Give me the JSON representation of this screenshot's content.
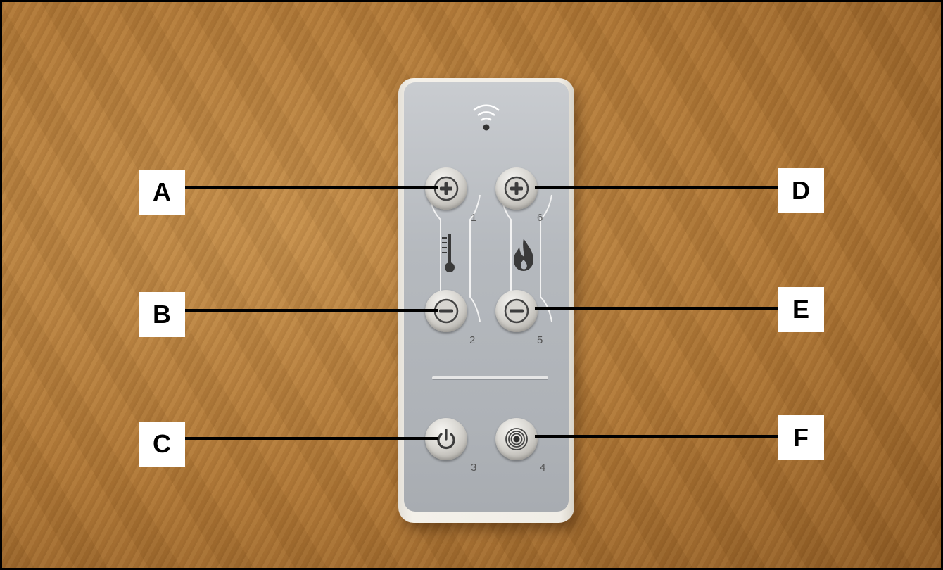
{
  "labels": {
    "a": "A",
    "b": "B",
    "c": "C",
    "d": "D",
    "e": "E",
    "f": "F"
  },
  "button_numbers": {
    "temp_up": "1",
    "temp_down": "2",
    "power": "3",
    "thermostat": "4",
    "flame_down": "5",
    "flame_up": "6"
  },
  "icons": {
    "signal": "wireless-signal-icon",
    "temp_up": "plus-icon",
    "temp_down": "minus-icon",
    "flame_up": "plus-icon",
    "flame_down": "minus-icon",
    "power": "power-icon",
    "thermostat": "concentric-circles-icon",
    "temperature": "thermometer-icon",
    "flame": "flame-icon"
  },
  "colors": {
    "wood": "#ad7535",
    "remote_face": "#b5b9be",
    "label_box": "#ffffff",
    "leader_line": "#000000"
  }
}
